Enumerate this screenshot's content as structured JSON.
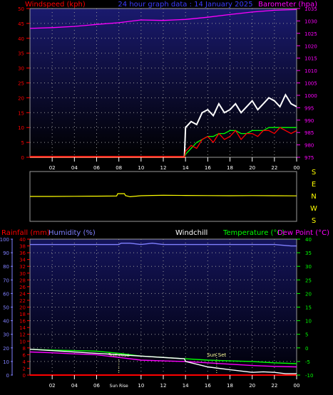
{
  "header": {
    "left_label": "Windspeed (kph)",
    "center_label": "24 hour graph data : 14 January 2025",
    "right_label": "Barometer (hpa)"
  },
  "hour_labels": [
    "02",
    "04",
    "06",
    "08",
    "10",
    "12",
    "14",
    "16",
    "18",
    "20",
    "22",
    "00"
  ],
  "direction_labels": [
    "S",
    "E",
    "N",
    "W",
    "S"
  ],
  "lower_header": {
    "rain_label": "Rainfall (mm)",
    "humidity_label": "Humidity (%)",
    "windchill_label": "Windchill",
    "temperature_label": "Temperature (°C)",
    "dewpoint_label": "Dew Point (°C)"
  },
  "annotations": {
    "sun_rise": "Sun Rise",
    "sun_set": "Sun Set",
    "sun_rise_time": "Sun Rise"
  },
  "colors": {
    "bg_top": "#1a1a6e",
    "bg_bottom": "#000000",
    "wind_speed": "#ff0000",
    "wind_gust": "#ffffff",
    "wind_avg": "#00ff00",
    "barometer": "#ff00ff",
    "direction": "#ffff00",
    "rain": "#ff0000",
    "humidity": "#8080ff",
    "temperature": "#00ff00",
    "dewpoint": "#ff00ff",
    "windchill": "#ffffff"
  },
  "chart_data": [
    {
      "type": "line",
      "name": "wind_and_barometer",
      "x_unit": "hour",
      "x_range": [
        0,
        24
      ],
      "left_axis": {
        "label": "Windspeed (kph)",
        "ylim": [
          0,
          50
        ],
        "ticks": [
          0,
          5,
          10,
          15,
          20,
          25,
          30,
          35,
          40,
          45,
          50
        ]
      },
      "right_axis": {
        "label": "Barometer (hpa)",
        "ylim": [
          975,
          1035
        ],
        "ticks": [
          975,
          980,
          985,
          990,
          995,
          1000,
          1005,
          1010,
          1015,
          1020,
          1025,
          1030,
          1035
        ]
      },
      "series": [
        {
          "name": "Barometer (hpa)",
          "axis": "right",
          "x": [
            0,
            2,
            4,
            6,
            8,
            10,
            12,
            14,
            16,
            18,
            20,
            22,
            24
          ],
          "y": [
            1027,
            1027.3,
            1027.8,
            1028.6,
            1029.3,
            1030.4,
            1030.2,
            1030.6,
            1031.5,
            1032.6,
            1033.6,
            1034.3,
            1034.6
          ]
        },
        {
          "name": "wind_gust",
          "axis": "left",
          "x": [
            0,
            13.9,
            14,
            14.5,
            15,
            15.5,
            16,
            16.5,
            17,
            17.5,
            18,
            18.5,
            19,
            19.5,
            20,
            20.5,
            21,
            21.5,
            22,
            22.5,
            23,
            23.5,
            24
          ],
          "y": [
            0,
            0,
            10,
            12,
            11,
            15,
            16,
            14,
            18,
            15,
            16,
            18,
            15,
            17,
            19,
            16,
            18,
            20,
            19,
            17,
            21,
            18,
            17
          ]
        },
        {
          "name": "wind_avg",
          "axis": "left",
          "x": [
            0,
            13.9,
            14,
            14.5,
            15,
            15.5,
            16,
            16.5,
            17,
            17.5,
            18,
            18.5,
            19,
            19.5,
            20,
            20.5,
            21,
            21.5,
            22,
            22.5,
            23,
            23.5,
            24
          ],
          "y": [
            0,
            0,
            1,
            3,
            5,
            6,
            7,
            7,
            8,
            8,
            9,
            9,
            8,
            8,
            9,
            9,
            9,
            10,
            10,
            10,
            10,
            10,
            10
          ]
        },
        {
          "name": "wind_speed",
          "axis": "left",
          "x": [
            0,
            13.9,
            14,
            14.5,
            15,
            15.5,
            16,
            16.5,
            17,
            17.5,
            18,
            18.5,
            19,
            19.5,
            20,
            20.5,
            21,
            21.5,
            22,
            22.5,
            23,
            23.5,
            24
          ],
          "y": [
            0,
            0,
            2,
            4,
            3,
            6,
            7,
            5,
            8,
            6,
            7,
            9,
            6,
            8,
            8,
            7,
            9,
            9,
            8,
            10,
            9,
            8,
            9
          ]
        }
      ]
    },
    {
      "type": "line",
      "name": "wind_direction",
      "x_unit": "hour",
      "x_range": [
        0,
        24
      ],
      "ylim": [
        0,
        360
      ],
      "series": [
        {
          "name": "direction",
          "x": [
            0,
            2,
            4,
            6,
            7.8,
            7.9,
            8.5,
            8.6,
            9,
            10,
            11,
            12,
            14,
            16,
            18,
            20,
            22,
            24
          ],
          "y": [
            180,
            180,
            181,
            182,
            183,
            200,
            200,
            186,
            178,
            185,
            187,
            188,
            187,
            186,
            185,
            186,
            185,
            184
          ]
        }
      ]
    },
    {
      "type": "line",
      "name": "temperature_humidity_rain",
      "x_unit": "hour",
      "x_range": [
        0,
        24
      ],
      "humidity_axis": {
        "label": "Humidity (%)",
        "ylim": [
          0,
          100
        ],
        "ticks": [
          0,
          10,
          20,
          30,
          40,
          50,
          60,
          70,
          80,
          90,
          100
        ]
      },
      "rain_axis": {
        "label": "Rainfall (mm)",
        "ylim": [
          0,
          40
        ],
        "ticks": [
          0,
          2,
          4,
          6,
          8,
          10,
          12,
          14,
          16,
          18,
          20,
          22,
          24,
          26,
          28,
          30,
          32,
          34,
          36,
          38,
          40
        ]
      },
      "temperature_axis": {
        "label": "Temperature (°C)",
        "ylim": [
          -10,
          40
        ],
        "ticks": [
          -10,
          -5,
          0,
          5,
          10,
          15,
          20,
          25,
          30,
          35,
          40
        ]
      },
      "series": [
        {
          "name": "Humidity (%)",
          "axis": "humidity",
          "x": [
            0,
            6,
            8,
            8.2,
            9,
            10,
            11,
            12,
            14,
            18,
            22,
            23.5,
            24
          ],
          "y": [
            96,
            96,
            96,
            97,
            97,
            96,
            97,
            96,
            96,
            96,
            96,
            95,
            95
          ]
        },
        {
          "name": "Temperature (°C)",
          "axis": "temperature",
          "x": [
            0,
            2,
            4,
            6,
            8,
            10,
            12,
            14,
            16,
            18,
            20,
            22,
            24
          ],
          "y": [
            -0.5,
            -0.8,
            -1,
            -1.2,
            -2,
            -3,
            -3.5,
            -4,
            -4.5,
            -4.8,
            -5,
            -5.5,
            -5.8
          ]
        },
        {
          "name": "Dew Point (°C)",
          "axis": "temperature",
          "x": [
            0,
            2,
            4,
            6,
            8,
            10,
            12,
            14,
            16,
            18,
            20,
            22,
            24
          ],
          "y": [
            -1.5,
            -1.8,
            -2.2,
            -2.5,
            -3.5,
            -4.5,
            -4.8,
            -5,
            -5.5,
            -6,
            -6.5,
            -6.8,
            -7
          ]
        },
        {
          "name": "Windchill",
          "axis": "temperature",
          "x": [
            0,
            13.9,
            14,
            15,
            16,
            17,
            18,
            19,
            20,
            21,
            22,
            23,
            24
          ],
          "y": [
            -0.5,
            -4,
            -5,
            -6,
            -7,
            -7.5,
            -8,
            -8.5,
            -9,
            -8.8,
            -9,
            -9.5,
            -9.5
          ]
        },
        {
          "name": "Rainfall (mm)",
          "axis": "rain",
          "x": [
            0,
            24
          ],
          "y": [
            0,
            0
          ]
        }
      ],
      "markers": [
        {
          "label": "Sun Rise",
          "x": 8.0
        },
        {
          "label": "Sun Set",
          "x": 16.8
        }
      ]
    }
  ]
}
